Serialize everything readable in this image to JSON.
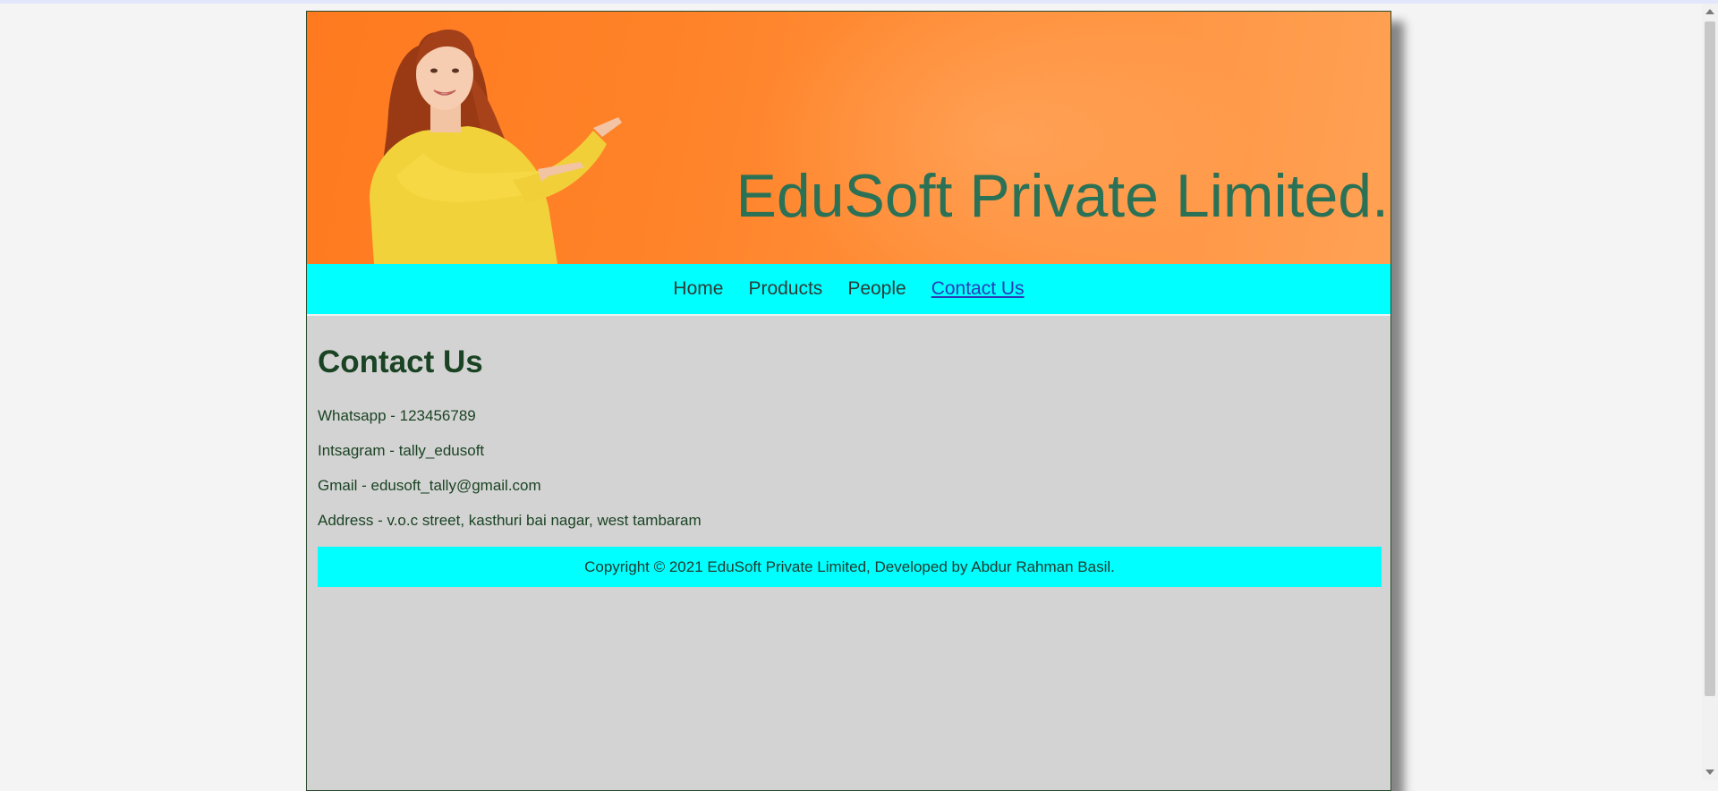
{
  "banner": {
    "title": "EduSoft Private Limited."
  },
  "nav": {
    "items": [
      {
        "label": "Home",
        "active": false
      },
      {
        "label": "Products",
        "active": false
      },
      {
        "label": "People",
        "active": false
      },
      {
        "label": "Contact Us",
        "active": true
      }
    ]
  },
  "contact": {
    "heading": "Contact Us",
    "lines": [
      "Whatsapp - 123456789",
      "Intsagram - tally_edusoft",
      "Gmail - edusoft_tally@gmail.com",
      "Address - v.o.c street, kasthuri bai nagar, west tambaram"
    ]
  },
  "footer": {
    "text": "Copyright © 2021 EduSoft Private Limited, Developed by Abdur Rahman Basil."
  },
  "colors": {
    "banner": "#ff8329",
    "nav": "#00ffff",
    "title": "#2b7155",
    "text": "#1a4323",
    "content_bg": "#d3d3d3"
  }
}
